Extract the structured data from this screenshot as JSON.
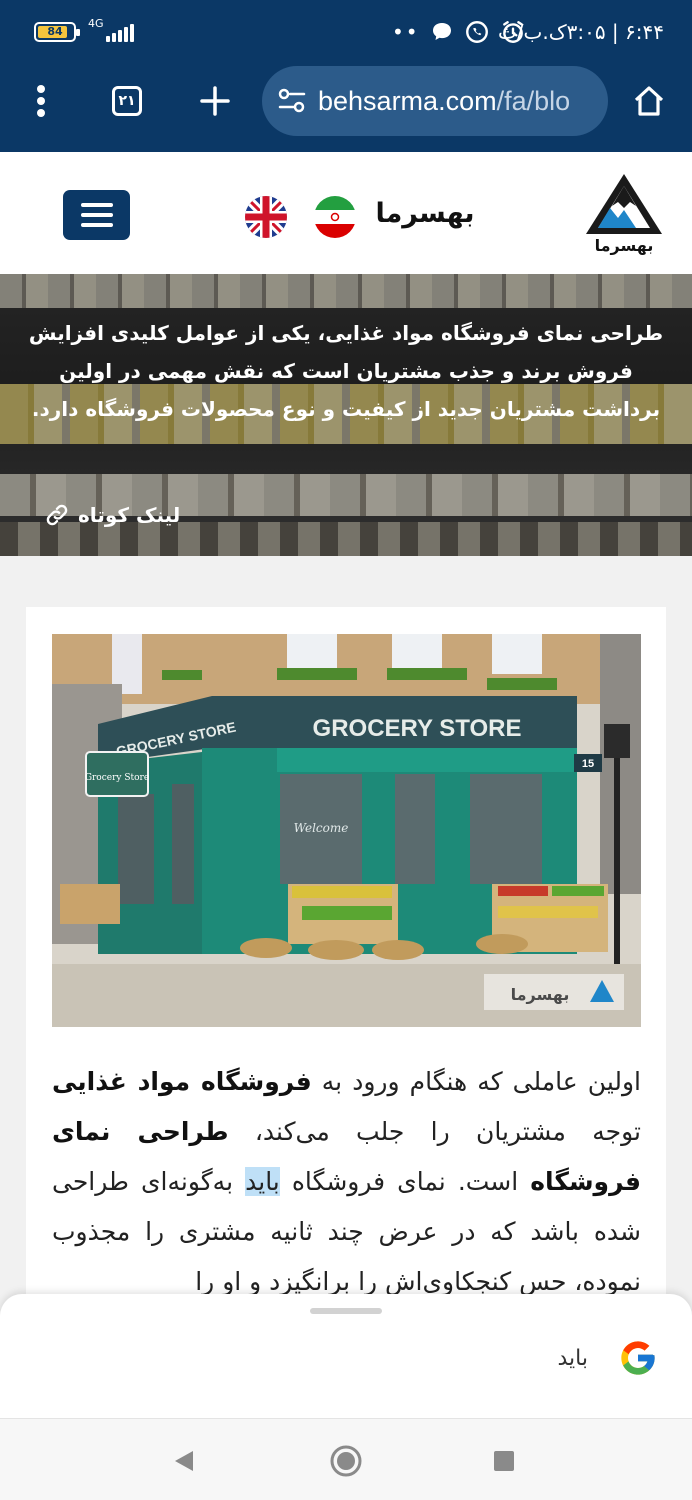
{
  "status_bar": {
    "battery_level": "84",
    "battery_fraction": 0.84,
    "network": "4G",
    "time": "۶:۴۴ | ۳:۰۵ک.ب/ث",
    "icons": [
      "dots-icon",
      "chat-bubble-icon",
      "whatsapp-icon",
      "alarm-icon",
      "signal-icon"
    ]
  },
  "browser": {
    "url_domain": "behsarma.com",
    "url_path": "/fa/blo",
    "tab_count": "۲۱",
    "icons": [
      "home-icon",
      "site-settings-icon",
      "new-tab-icon",
      "tab-switcher-icon",
      "more-menu-icon"
    ]
  },
  "site": {
    "brand_name": "بهسرما",
    "logo_text": "بهسرما",
    "flags": [
      "iran-flag-icon",
      "uk-flag-icon"
    ],
    "colors": {
      "primary": "#0b3866",
      "highlight": "#bfe0f7"
    }
  },
  "hero": {
    "text": "طراحی نمای فروشگاه مواد غذایی، یکی از عوامل کلیدی افزایش فروش برند و جذب مشتریان است که نقش مهمی در اولین برداشت مشتریان جدید از کیفیت و نوع محصولات فروشگاه دارد.",
    "short_link": "لینک کوتاه"
  },
  "image": {
    "sign_main": "GROCERY STORE",
    "sign_side": "GROCERY STORE",
    "small_sign": "Grocery Store",
    "welcome": "Welcome",
    "number": "15",
    "watermark": "بهسرما"
  },
  "article": {
    "p1_a": "اولین عاملی که هنگام ورود به ",
    "p1_b": "فروشگاه مواد غذایی",
    "p1_c": " توجه مشتریان را جلب می‌کند، ",
    "p1_d": "طراحی نمای فروشگاه",
    "p1_e": " است. نمای فروشگاه ",
    "p1_f": "باید",
    "p1_g": " به‌گونه‌ای طراحی شده باشد که در عرض چند ثانیه مشتری را مجذوب نموده، حس کنجکاوی‌اش را برانگیزد و او را"
  },
  "sheet": {
    "query": "باید"
  }
}
